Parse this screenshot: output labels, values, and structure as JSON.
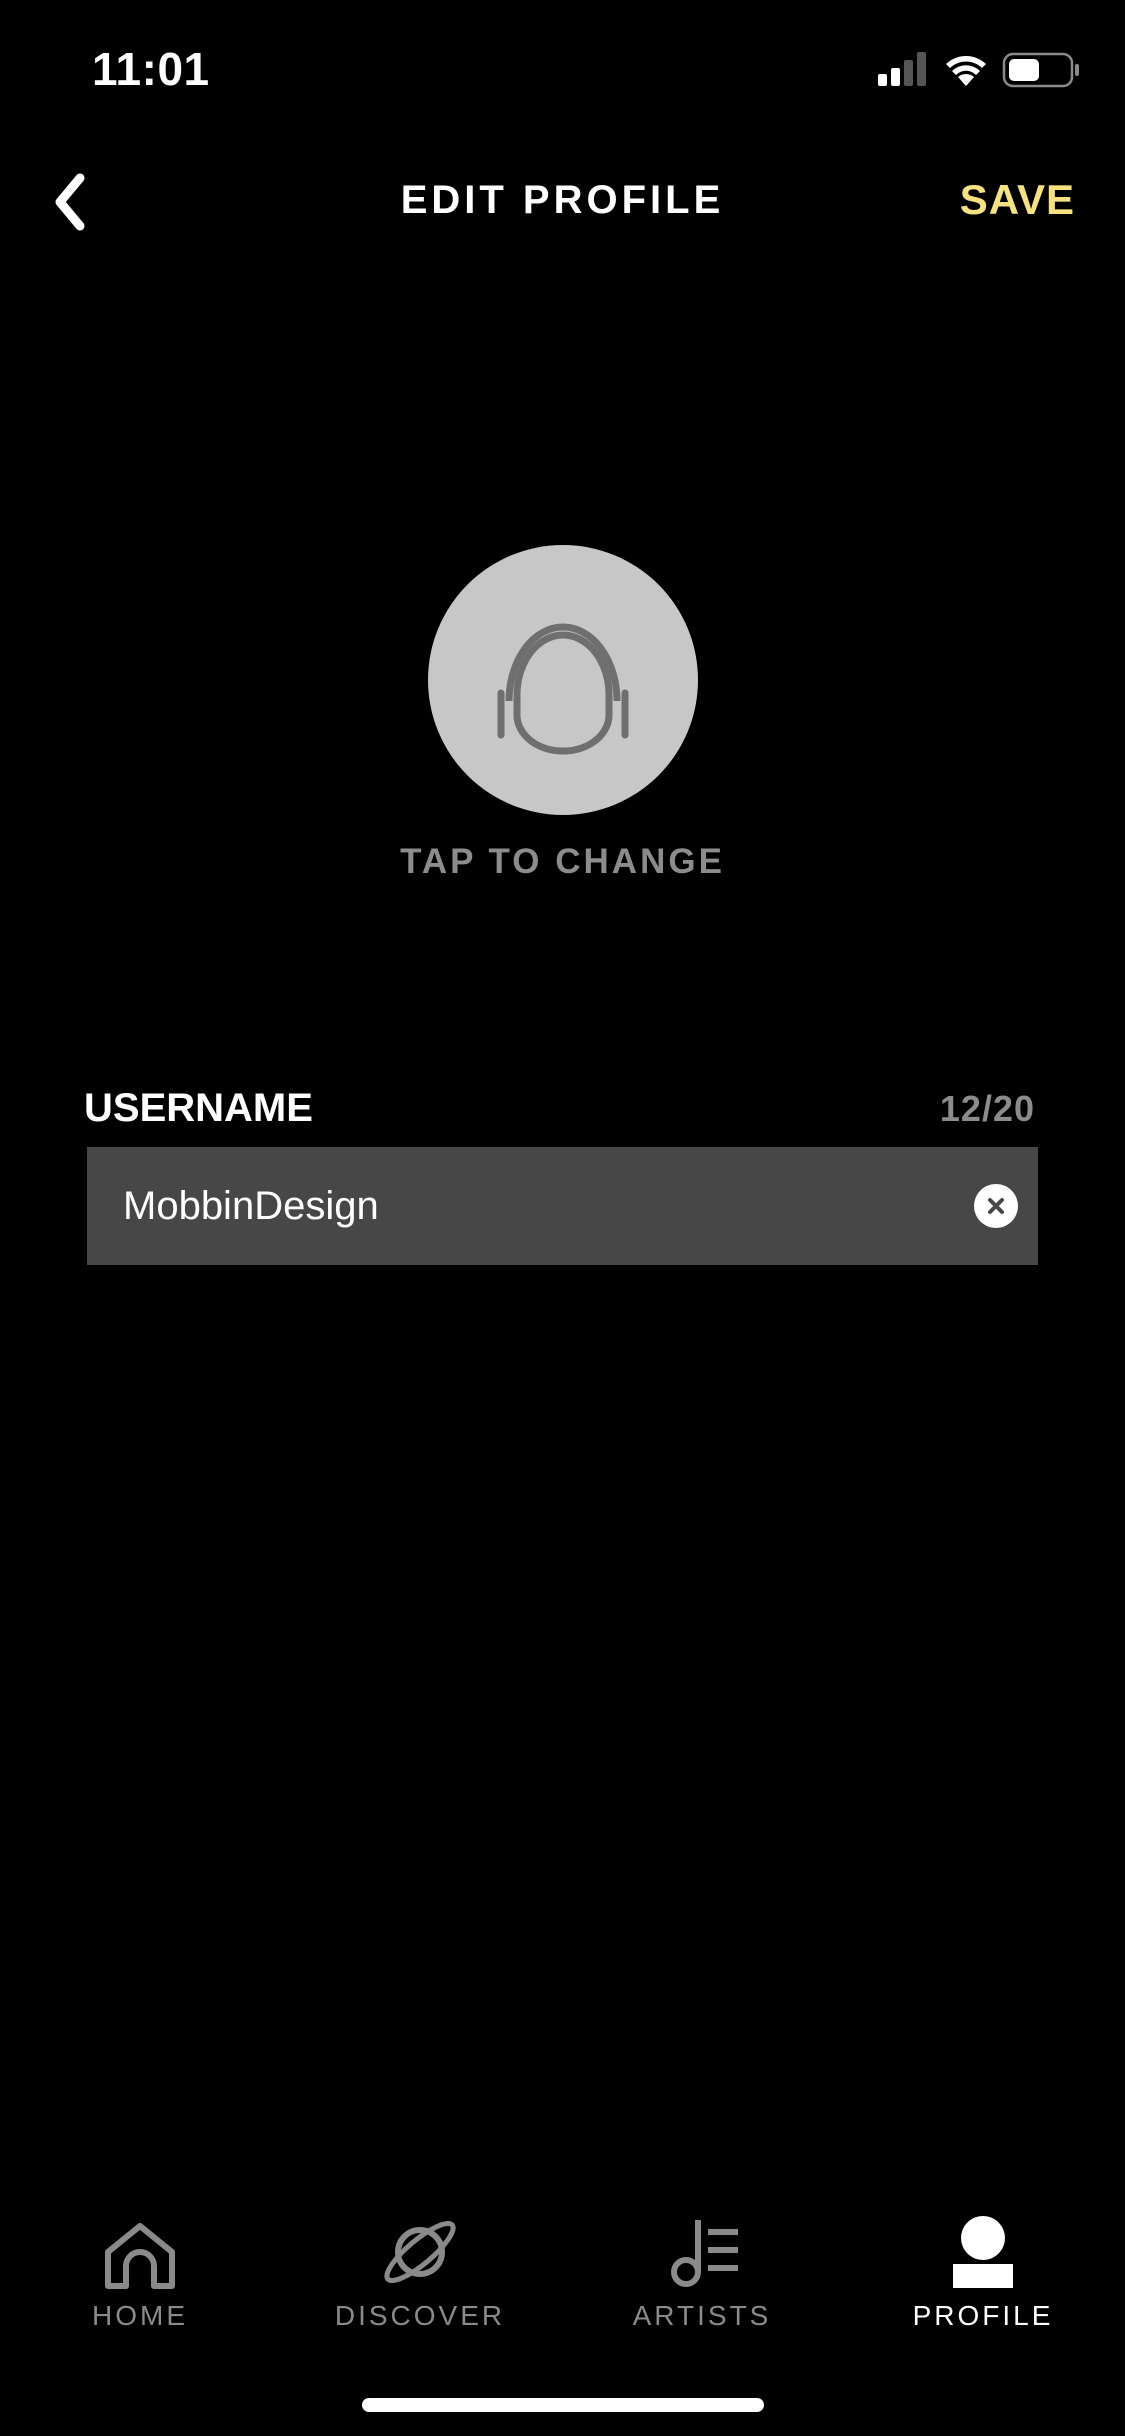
{
  "status_bar": {
    "time": "11:01",
    "icons": [
      "signal-icon",
      "wifi-icon",
      "battery-icon"
    ]
  },
  "header": {
    "title": "EDIT PROFILE",
    "save_label": "SAVE",
    "back_icon": "chevron-left-icon"
  },
  "avatar": {
    "icon": "headphones-helmet-icon",
    "caption": "TAP TO CHANGE"
  },
  "username": {
    "label": "USERNAME",
    "counter": "12/20",
    "value": "MobbinDesign",
    "clear_icon": "clear-icon"
  },
  "tab_bar": {
    "tabs": [
      {
        "label": "HOME",
        "icon": "home-icon",
        "active": false
      },
      {
        "label": "DISCOVER",
        "icon": "planet-icon",
        "active": false
      },
      {
        "label": "ARTISTS",
        "icon": "music-note-list-icon",
        "active": false
      },
      {
        "label": "PROFILE",
        "icon": "profile-icon",
        "active": true
      }
    ]
  },
  "colors": {
    "background": "#000000",
    "accent": "#f6e27f",
    "field_bg": "#474747",
    "muted_text": "#8c8c8c",
    "avatar_bg": "#c7c7c7"
  }
}
